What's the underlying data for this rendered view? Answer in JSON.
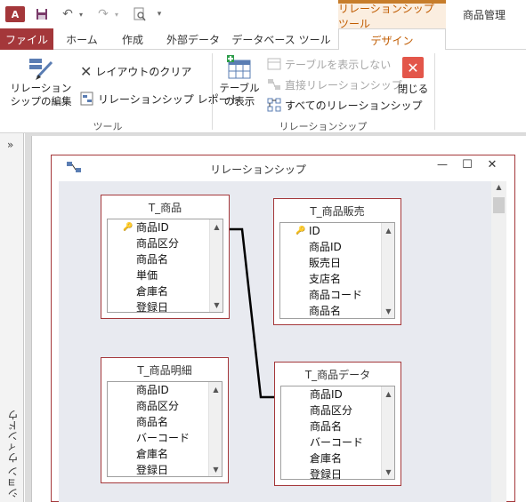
{
  "app": {
    "logo_text": "A",
    "window_title": "商品管理",
    "contextual_tab_group": "リレーションシップ ツール"
  },
  "tabs": {
    "file": "ファイル",
    "home": "ホーム",
    "create": "作成",
    "external": "外部データ",
    "dbtools": "データベース ツール",
    "design": "デザイン"
  },
  "ribbon": {
    "tools": {
      "label": "ツール",
      "edit_relationships": "リレーションシップの編集",
      "clear_layout": "レイアウトのクリア",
      "relationship_report": "リレーションシップ レポート"
    },
    "relationships": {
      "label": "リレーションシップ",
      "show_table": "テーブルの表示",
      "hide_table": "テーブルを表示しない",
      "direct_relationships": "直接リレーションシップ",
      "all_relationships": "すべてのリレーションシップ"
    },
    "close": "閉じる"
  },
  "nav_pane": {
    "toggle": "»",
    "label": "ション ウィンドウ"
  },
  "relationship_window": {
    "title": "リレーションシップ",
    "minimize": "—",
    "maximize": "☐",
    "close": "✕"
  },
  "tables": [
    {
      "name": "T_商品",
      "fields": [
        {
          "name": "商品ID",
          "key": true
        },
        {
          "name": "商品区分",
          "key": false
        },
        {
          "name": "商品名",
          "key": false
        },
        {
          "name": "単価",
          "key": false
        },
        {
          "name": "倉庫名",
          "key": false
        },
        {
          "name": "登録日",
          "key": false
        }
      ]
    },
    {
      "name": "T_商品販売",
      "fields": [
        {
          "name": "ID",
          "key": true
        },
        {
          "name": "商品ID",
          "key": false
        },
        {
          "name": "販売日",
          "key": false
        },
        {
          "name": "支店名",
          "key": false
        },
        {
          "name": "商品コード",
          "key": false
        },
        {
          "name": "商品名",
          "key": false
        }
      ]
    },
    {
      "name": "T_商品明細",
      "fields": [
        {
          "name": "商品ID",
          "key": false
        },
        {
          "name": "商品区分",
          "key": false
        },
        {
          "name": "商品名",
          "key": false
        },
        {
          "name": "バーコード",
          "key": false
        },
        {
          "name": "倉庫名",
          "key": false
        },
        {
          "name": "登録日",
          "key": false
        }
      ]
    },
    {
      "name": "T_商品データ",
      "fields": [
        {
          "name": "商品ID",
          "key": false
        },
        {
          "name": "商品区分",
          "key": false
        },
        {
          "name": "商品名",
          "key": false
        },
        {
          "name": "バーコード",
          "key": false
        },
        {
          "name": "倉庫名",
          "key": false
        },
        {
          "name": "登録日",
          "key": false
        }
      ]
    }
  ],
  "icons": {
    "save": "save-icon",
    "undo": "undo-icon",
    "redo": "redo-icon",
    "print_preview": "print-preview-icon",
    "key": "key-icon"
  },
  "colors": {
    "accent": "#a4373a",
    "contextual": "#c05b00",
    "canvas": "#e8eaf0"
  }
}
